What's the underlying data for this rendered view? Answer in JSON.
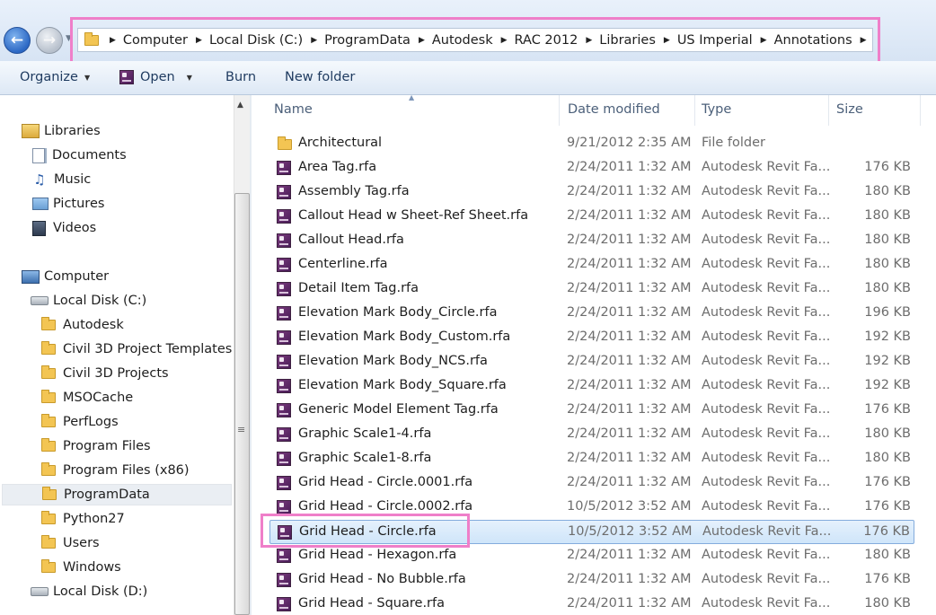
{
  "address_bar": {
    "breadcrumbs": [
      "Computer",
      "Local Disk (C:)",
      "ProgramData",
      "Autodesk",
      "RAC 2012",
      "Libraries",
      "US Imperial",
      "Annotations"
    ]
  },
  "toolbar": {
    "organize_label": "Organize",
    "open_label": "Open",
    "burn_label": "Burn",
    "new_folder_label": "New folder"
  },
  "nav": {
    "libraries_label": "Libraries",
    "libraries": [
      "Documents",
      "Music",
      "Pictures",
      "Videos"
    ],
    "computer_label": "Computer",
    "local_disk_c": "Local Disk (C:)",
    "folders": [
      "Autodesk",
      "Civil 3D Project Templates",
      "Civil 3D Projects",
      "MSOCache",
      "PerfLogs",
      "Program Files",
      "Program Files (x86)",
      "ProgramData",
      "Python27",
      "Users",
      "Windows"
    ],
    "selected_folder": "ProgramData",
    "local_disk_d": "Local Disk (D:)"
  },
  "columns": {
    "name": "Name",
    "date": "Date modified",
    "type": "Type",
    "size": "Size"
  },
  "files": [
    {
      "name": "Architectural",
      "date": "9/21/2012 2:35 AM",
      "type": "File folder",
      "size": "",
      "kind": "folder"
    },
    {
      "name": "Area Tag.rfa",
      "date": "2/24/2011 1:32 AM",
      "type": "Autodesk Revit Fa...",
      "size": "176 KB",
      "kind": "rfa"
    },
    {
      "name": "Assembly Tag.rfa",
      "date": "2/24/2011 1:32 AM",
      "type": "Autodesk Revit Fa...",
      "size": "180 KB",
      "kind": "rfa"
    },
    {
      "name": "Callout Head w Sheet-Ref Sheet.rfa",
      "date": "2/24/2011 1:32 AM",
      "type": "Autodesk Revit Fa...",
      "size": "180 KB",
      "kind": "rfa"
    },
    {
      "name": "Callout Head.rfa",
      "date": "2/24/2011 1:32 AM",
      "type": "Autodesk Revit Fa...",
      "size": "180 KB",
      "kind": "rfa"
    },
    {
      "name": "Centerline.rfa",
      "date": "2/24/2011 1:32 AM",
      "type": "Autodesk Revit Fa...",
      "size": "180 KB",
      "kind": "rfa"
    },
    {
      "name": "Detail Item Tag.rfa",
      "date": "2/24/2011 1:32 AM",
      "type": "Autodesk Revit Fa...",
      "size": "180 KB",
      "kind": "rfa"
    },
    {
      "name": "Elevation Mark Body_Circle.rfa",
      "date": "2/24/2011 1:32 AM",
      "type": "Autodesk Revit Fa...",
      "size": "196 KB",
      "kind": "rfa"
    },
    {
      "name": "Elevation Mark Body_Custom.rfa",
      "date": "2/24/2011 1:32 AM",
      "type": "Autodesk Revit Fa...",
      "size": "192 KB",
      "kind": "rfa"
    },
    {
      "name": "Elevation Mark Body_NCS.rfa",
      "date": "2/24/2011 1:32 AM",
      "type": "Autodesk Revit Fa...",
      "size": "192 KB",
      "kind": "rfa"
    },
    {
      "name": "Elevation Mark Body_Square.rfa",
      "date": "2/24/2011 1:32 AM",
      "type": "Autodesk Revit Fa...",
      "size": "192 KB",
      "kind": "rfa"
    },
    {
      "name": "Generic Model Element Tag.rfa",
      "date": "2/24/2011 1:32 AM",
      "type": "Autodesk Revit Fa...",
      "size": "176 KB",
      "kind": "rfa"
    },
    {
      "name": "Graphic Scale1-4.rfa",
      "date": "2/24/2011 1:32 AM",
      "type": "Autodesk Revit Fa...",
      "size": "180 KB",
      "kind": "rfa"
    },
    {
      "name": "Graphic Scale1-8.rfa",
      "date": "2/24/2011 1:32 AM",
      "type": "Autodesk Revit Fa...",
      "size": "180 KB",
      "kind": "rfa"
    },
    {
      "name": "Grid Head - Circle.0001.rfa",
      "date": "2/24/2011 1:32 AM",
      "type": "Autodesk Revit Fa...",
      "size": "176 KB",
      "kind": "rfa"
    },
    {
      "name": "Grid Head - Circle.0002.rfa",
      "date": "10/5/2012 3:52 AM",
      "type": "Autodesk Revit Fa...",
      "size": "176 KB",
      "kind": "rfa"
    },
    {
      "name": "Grid Head - Circle.rfa",
      "date": "10/5/2012 3:52 AM",
      "type": "Autodesk Revit Fa...",
      "size": "176 KB",
      "kind": "rfa",
      "selected": true
    },
    {
      "name": "Grid Head - Hexagon.rfa",
      "date": "2/24/2011 1:32 AM",
      "type": "Autodesk Revit Fa...",
      "size": "180 KB",
      "kind": "rfa"
    },
    {
      "name": "Grid Head - No Bubble.rfa",
      "date": "2/24/2011 1:32 AM",
      "type": "Autodesk Revit Fa...",
      "size": "176 KB",
      "kind": "rfa"
    },
    {
      "name": "Grid Head - Square.rfa",
      "date": "2/24/2011 1:32 AM",
      "type": "Autodesk Revit Fa...",
      "size": "180 KB",
      "kind": "rfa"
    }
  ],
  "colors": {
    "highlight_box": "#ef7fc9",
    "selection": "#cfe5fa",
    "toolbar_text": "#1e3a5f"
  }
}
